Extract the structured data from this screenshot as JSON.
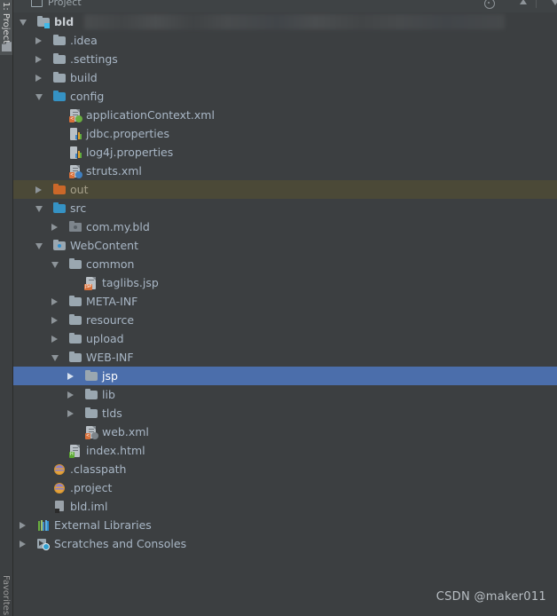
{
  "window": {
    "tool_window_tab_top": "1: Project",
    "tool_window_tab_bottom": "Favorites",
    "header_title": "Project",
    "background_color": "#3c3f41",
    "selection_color": "#4b6eab",
    "excluded_row_color": "#4b4937",
    "text_color": "#a9b7c6"
  },
  "header": {
    "icons": [
      "project-window-icon",
      "gear-icon",
      "collapse-all-icon",
      "hide-icon"
    ]
  },
  "tree": {
    "rows": [
      {
        "label": "bld",
        "indent": 0,
        "toggle": "expanded",
        "icon": "module-folder-icon",
        "bold": true,
        "state": "normal",
        "redacted_path": true
      },
      {
        "label": ".idea",
        "indent": 1,
        "toggle": "collapsed",
        "icon": "folder-gray-icon",
        "bold": false,
        "state": "normal"
      },
      {
        "label": ".settings",
        "indent": 1,
        "toggle": "collapsed",
        "icon": "folder-gray-icon",
        "bold": false,
        "state": "normal"
      },
      {
        "label": "build",
        "indent": 1,
        "toggle": "collapsed",
        "icon": "folder-gray-icon",
        "bold": false,
        "state": "normal"
      },
      {
        "label": "config",
        "indent": 1,
        "toggle": "expanded",
        "icon": "folder-blue-icon",
        "bold": false,
        "state": "normal"
      },
      {
        "label": "applicationContext.xml",
        "indent": 2,
        "toggle": "none",
        "icon": "xml-spring-file-icon",
        "bold": false,
        "state": "normal"
      },
      {
        "label": "jdbc.properties",
        "indent": 2,
        "toggle": "none",
        "icon": "properties-file-icon",
        "bold": false,
        "state": "normal"
      },
      {
        "label": "log4j.properties",
        "indent": 2,
        "toggle": "none",
        "icon": "properties-file-icon",
        "bold": false,
        "state": "normal"
      },
      {
        "label": "struts.xml",
        "indent": 2,
        "toggle": "none",
        "icon": "xml-struts-file-icon",
        "bold": false,
        "state": "normal"
      },
      {
        "label": "out",
        "indent": 1,
        "toggle": "collapsed",
        "icon": "folder-orange-icon",
        "bold": false,
        "state": "excluded"
      },
      {
        "label": "src",
        "indent": 1,
        "toggle": "expanded",
        "icon": "folder-blue-icon",
        "bold": false,
        "state": "normal"
      },
      {
        "label": "com.my.bld",
        "indent": 2,
        "toggle": "collapsed",
        "icon": "package-icon",
        "bold": false,
        "state": "normal"
      },
      {
        "label": "WebContent",
        "indent": 1,
        "toggle": "expanded",
        "icon": "resource-folder-icon",
        "bold": false,
        "state": "normal"
      },
      {
        "label": "common",
        "indent": 2,
        "toggle": "expanded",
        "icon": "folder-gray-icon",
        "bold": false,
        "state": "normal"
      },
      {
        "label": "taglibs.jsp",
        "indent": 3,
        "toggle": "none",
        "icon": "jsp-file-icon",
        "bold": false,
        "state": "normal"
      },
      {
        "label": "META-INF",
        "indent": 2,
        "toggle": "collapsed",
        "icon": "folder-gray-icon",
        "bold": false,
        "state": "normal"
      },
      {
        "label": "resource",
        "indent": 2,
        "toggle": "collapsed",
        "icon": "folder-gray-icon",
        "bold": false,
        "state": "normal"
      },
      {
        "label": "upload",
        "indent": 2,
        "toggle": "collapsed",
        "icon": "folder-gray-icon",
        "bold": false,
        "state": "normal"
      },
      {
        "label": "WEB-INF",
        "indent": 2,
        "toggle": "expanded",
        "icon": "folder-gray-icon",
        "bold": false,
        "state": "normal"
      },
      {
        "label": "jsp",
        "indent": 3,
        "toggle": "collapsed",
        "icon": "folder-gray-icon",
        "bold": false,
        "state": "selected"
      },
      {
        "label": "lib",
        "indent": 3,
        "toggle": "collapsed",
        "icon": "folder-gray-icon",
        "bold": false,
        "state": "normal"
      },
      {
        "label": "tlds",
        "indent": 3,
        "toggle": "collapsed",
        "icon": "folder-gray-icon",
        "bold": false,
        "state": "normal"
      },
      {
        "label": "web.xml",
        "indent": 3,
        "toggle": "none",
        "icon": "xml-web-file-icon",
        "bold": false,
        "state": "normal"
      },
      {
        "label": "index.html",
        "indent": 2,
        "toggle": "none",
        "icon": "html-file-icon",
        "bold": false,
        "state": "normal"
      },
      {
        "label": ".classpath",
        "indent": 1,
        "toggle": "none",
        "icon": "eclipse-classpath-icon",
        "bold": false,
        "state": "normal"
      },
      {
        "label": ".project",
        "indent": 1,
        "toggle": "none",
        "icon": "eclipse-project-icon",
        "bold": false,
        "state": "normal"
      },
      {
        "label": "bld.iml",
        "indent": 1,
        "toggle": "none",
        "icon": "iml-module-file-icon",
        "bold": false,
        "state": "normal"
      },
      {
        "label": "External Libraries",
        "indent": 0,
        "toggle": "collapsed",
        "icon": "external-libraries-icon",
        "bold": false,
        "state": "normal"
      },
      {
        "label": "Scratches and Consoles",
        "indent": 0,
        "toggle": "collapsed",
        "icon": "scratches-consoles-icon",
        "bold": false,
        "state": "normal"
      }
    ]
  },
  "watermark": {
    "text": "CSDN @maker011"
  }
}
